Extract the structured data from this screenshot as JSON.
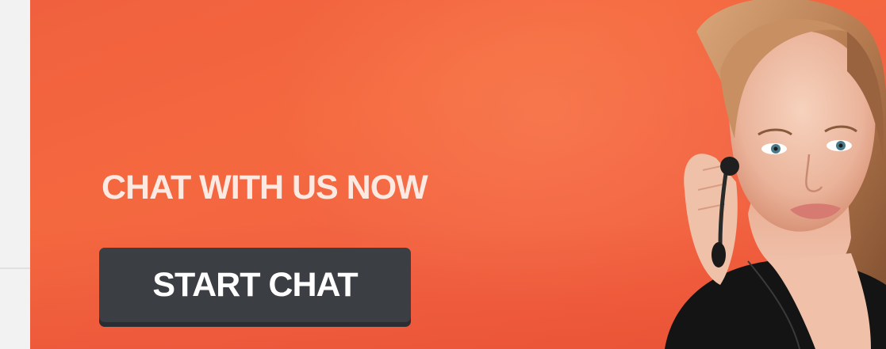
{
  "banner": {
    "headline": "CHAT WITH US NOW",
    "cta_label": "START CHAT",
    "colors": {
      "background": "#f26342",
      "headline": "#fbe9e2",
      "button": "#3b3f44",
      "button_text": "#ffffff"
    },
    "image": "support-agent-with-headset"
  }
}
